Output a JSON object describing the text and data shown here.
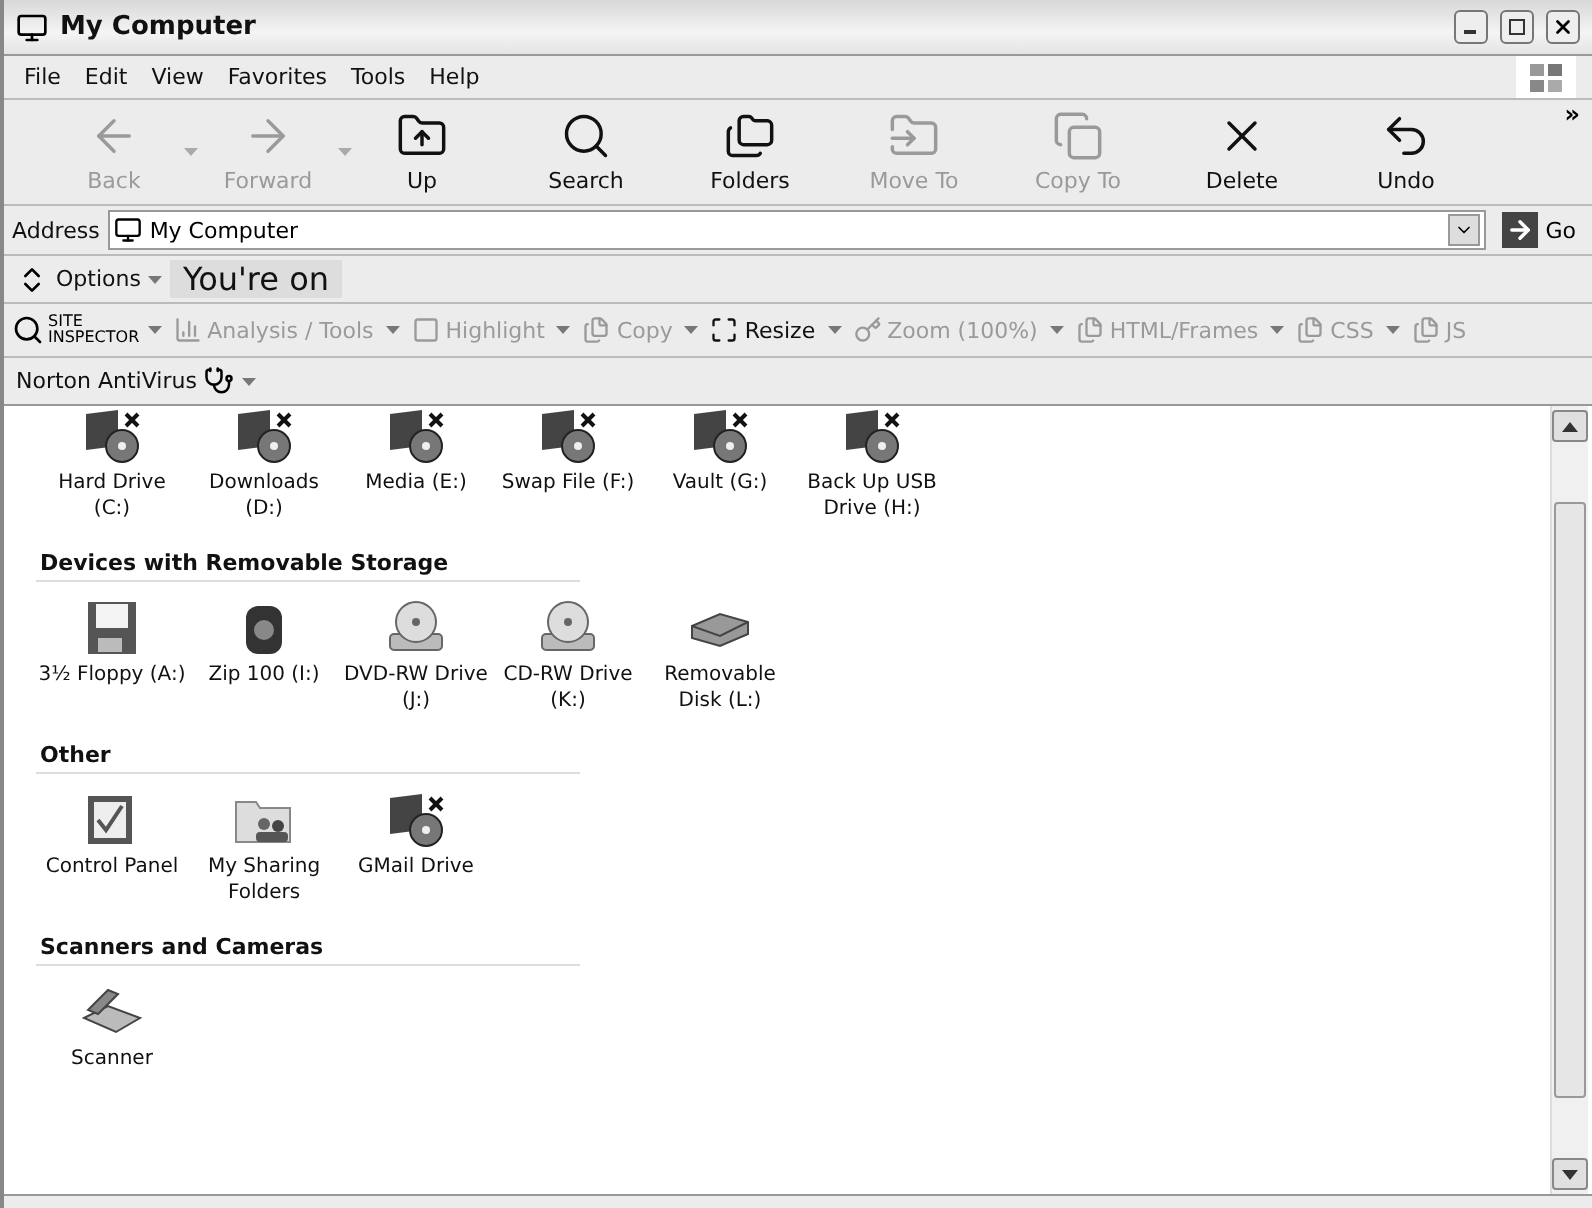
{
  "window": {
    "title": "My Computer"
  },
  "menu": [
    "File",
    "Edit",
    "View",
    "Favorites",
    "Tools",
    "Help"
  ],
  "toolbar": [
    {
      "label": "Back",
      "disabled": true,
      "dropdown": true
    },
    {
      "label": "Forward",
      "disabled": true,
      "dropdown": true
    },
    {
      "label": "Up",
      "disabled": false,
      "dropdown": false
    },
    {
      "label": "Search",
      "disabled": false,
      "dropdown": false
    },
    {
      "label": "Folders",
      "disabled": false,
      "dropdown": false
    },
    {
      "label": "Move To",
      "disabled": true,
      "dropdown": false
    },
    {
      "label": "Copy To",
      "disabled": true,
      "dropdown": false
    },
    {
      "label": "Delete",
      "disabled": false,
      "dropdown": false
    },
    {
      "label": "Undo",
      "disabled": false,
      "dropdown": false
    }
  ],
  "toolbar_overflow": "»",
  "address": {
    "label": "Address",
    "value": "My Computer",
    "go": "Go"
  },
  "options_bar": {
    "label": "Options",
    "banner": "You're on"
  },
  "inspector_bar": {
    "logo_lines": [
      "SITE",
      "INSPECTOR"
    ],
    "items": [
      {
        "label": "Analysis / Tools",
        "disabled": true
      },
      {
        "label": "Highlight",
        "disabled": true
      },
      {
        "label": "Copy",
        "disabled": true
      },
      {
        "label": "Resize",
        "disabled": false
      },
      {
        "label": "Zoom (100%)",
        "disabled": true
      },
      {
        "label": "HTML/Frames",
        "disabled": true
      },
      {
        "label": "CSS",
        "disabled": true
      },
      {
        "label": "JS",
        "disabled": true
      }
    ]
  },
  "norton_bar": {
    "label": "Norton AntiVirus"
  },
  "groups": [
    {
      "items": [
        {
          "label": "Hard Drive (C:)",
          "kind": "drive"
        },
        {
          "label": "Downloads (D:)",
          "kind": "drive"
        },
        {
          "label": "Media (E:)",
          "kind": "drive"
        },
        {
          "label": "Swap File (F:)",
          "kind": "drive"
        },
        {
          "label": "Vault (G:)",
          "kind": "drive"
        },
        {
          "label": "Back Up USB Drive (H:)",
          "kind": "drive"
        }
      ]
    },
    {
      "title": "Devices with Removable Storage",
      "items": [
        {
          "label": "3½ Floppy (A:)",
          "kind": "floppy"
        },
        {
          "label": "Zip 100  (I:)",
          "kind": "zip"
        },
        {
          "label": "DVD-RW Drive (J:)",
          "kind": "optical"
        },
        {
          "label": "CD-RW Drive (K:)",
          "kind": "optical"
        },
        {
          "label": "Removable Disk (L:)",
          "kind": "removable"
        }
      ]
    },
    {
      "title": "Other",
      "items": [
        {
          "label": "Control Panel",
          "kind": "control"
        },
        {
          "label": "My Sharing Folders",
          "kind": "sharing"
        },
        {
          "label": "GMail Drive",
          "kind": "drive"
        }
      ]
    },
    {
      "title": "Scanners and Cameras",
      "items": [
        {
          "label": "Scanner",
          "kind": "scanner"
        }
      ]
    }
  ]
}
